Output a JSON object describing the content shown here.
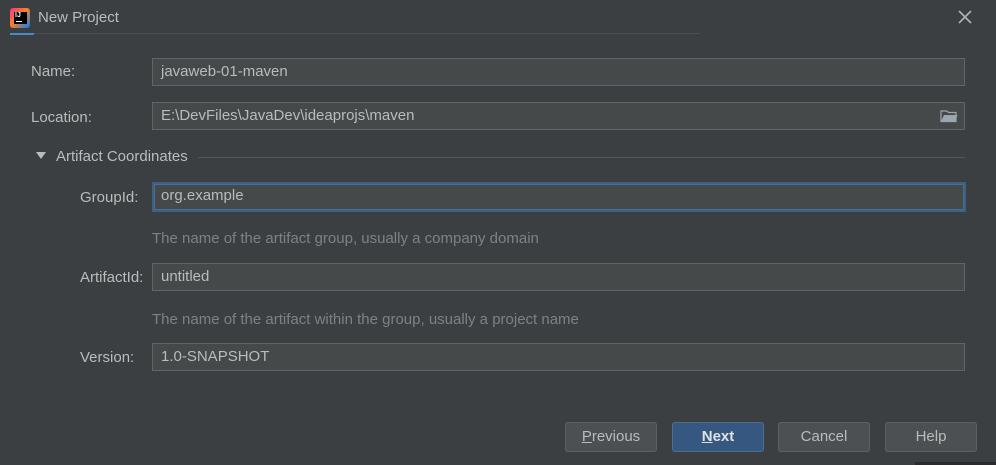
{
  "window": {
    "title": "New Project"
  },
  "form": {
    "name": {
      "label": "Name:",
      "value": "javaweb-01-maven"
    },
    "location": {
      "label": "Location:",
      "value": "E:\\DevFiles\\JavaDev\\ideaprojs\\maven"
    },
    "section": {
      "label": "Artifact Coordinates"
    },
    "group_id": {
      "label": "GroupId:",
      "value": "org.example",
      "hint": "The name of the artifact group, usually a company domain"
    },
    "artifact_id": {
      "label": "ArtifactId:",
      "value": "untitled",
      "hint": "The name of the artifact within the group, usually a project name"
    },
    "version": {
      "label": "Version:",
      "value": "1.0-SNAPSHOT"
    }
  },
  "buttons": {
    "previous": {
      "mnemonic": "P",
      "rest": "revious"
    },
    "next": {
      "mnemonic": "N",
      "rest": "ext"
    },
    "cancel": "Cancel",
    "help": "Help"
  },
  "icons": {
    "app": "intellij-idea-icon",
    "close": "close-icon",
    "folder": "folder-icon",
    "collapse": "triangle-down-icon"
  },
  "colors": {
    "background": "#3c3f41",
    "field_background": "#45494a",
    "focus_border": "#3d6185",
    "primary_button": "#365880",
    "hint_text": "#808080"
  }
}
